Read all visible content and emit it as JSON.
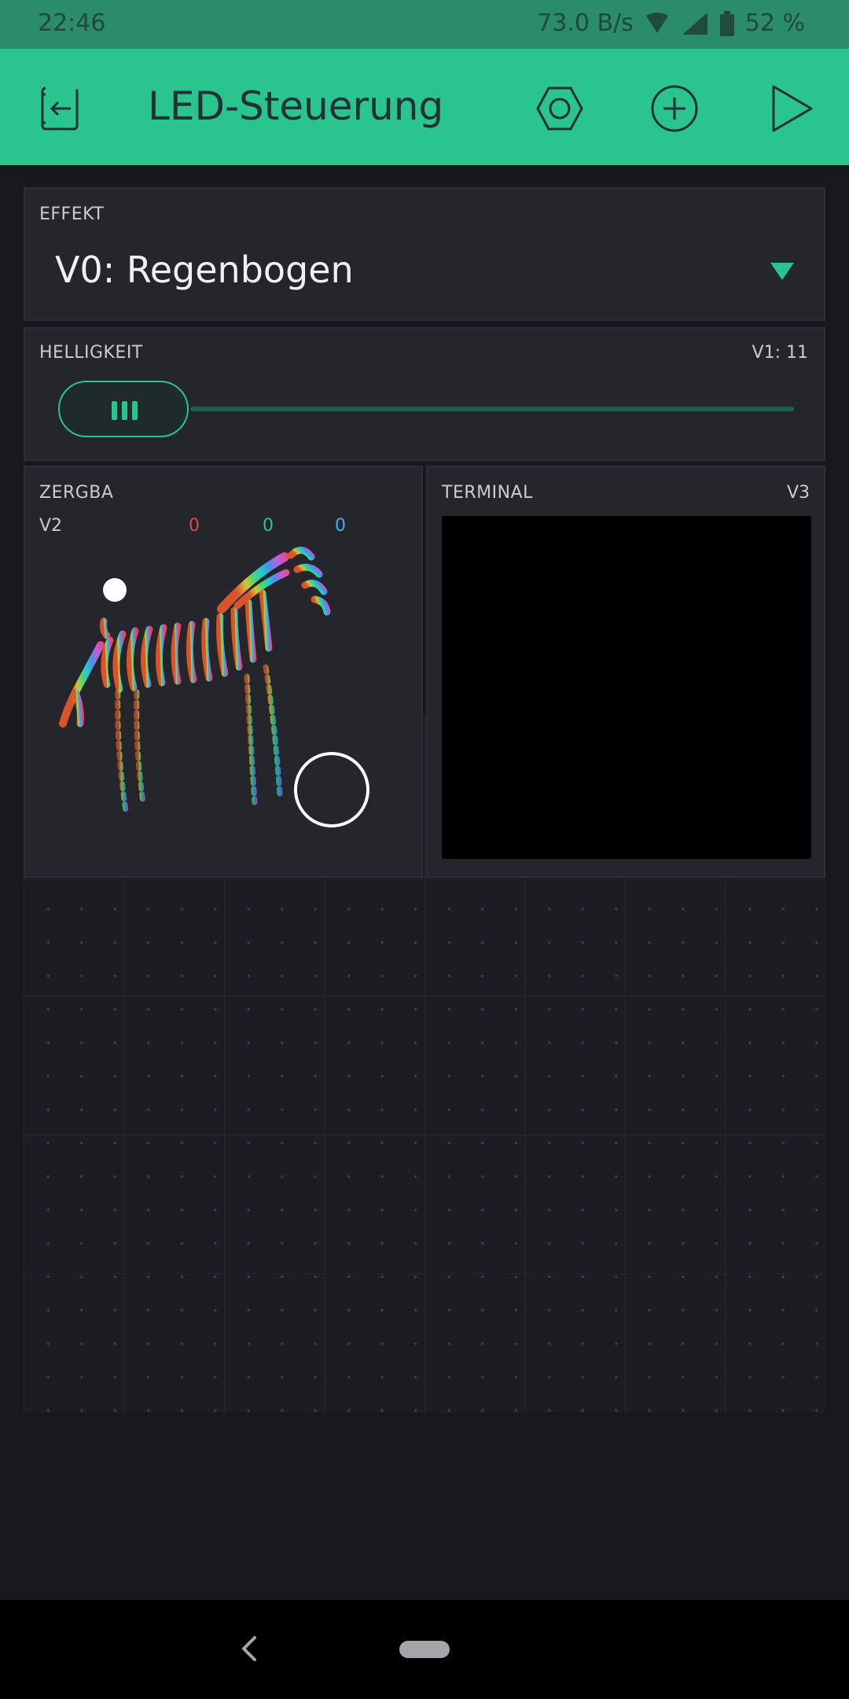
{
  "status_bar": {
    "time": "22:46",
    "net_speed": "73.0 B/s",
    "battery": "52 %"
  },
  "app_bar": {
    "title": "LED-Steuerung"
  },
  "effekt": {
    "label": "EFFEKT",
    "value": "V0: Regenbogen"
  },
  "helligkeit": {
    "label": "HELLIGKEIT",
    "pin_value": "V1: 11"
  },
  "zergba": {
    "label": "ZERGBA",
    "pin": "V2",
    "r": "0",
    "g": "0",
    "b": "0"
  },
  "terminal": {
    "label": "TERMINAL",
    "pin": "V3"
  },
  "colors": {
    "accent": "#2ac58f",
    "red": "#e2455f",
    "blue": "#3fb1e6",
    "status_bar": "#2a8c6b"
  },
  "icons": [
    "exit-icon",
    "hexagon-settings-icon",
    "plus-circle-icon",
    "play-icon",
    "wifi-icon",
    "signal-icon",
    "battery-icon",
    "zebra-color-picker",
    "back-icon"
  ]
}
